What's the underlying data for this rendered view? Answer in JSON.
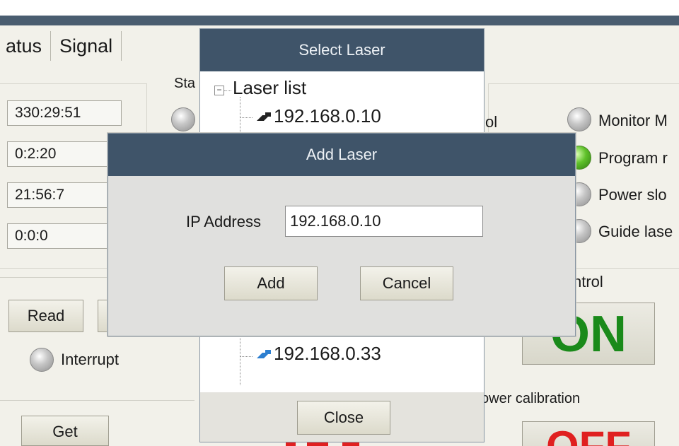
{
  "tabs": [
    "atus",
    "Signal"
  ],
  "left_panel": {
    "fields": [
      "330:29:51",
      "0:2:20",
      "21:56:7",
      "0:0:0"
    ],
    "read_button": "Read",
    "interrupt_label": "Interrupt",
    "get_button": "Get"
  },
  "middle": {
    "status_label_partial": "Sta"
  },
  "right_panel": {
    "control_partial": "ol",
    "indicators": [
      "Monitor M",
      "Program r",
      "Power slo",
      "Guide lase"
    ],
    "indicator_states": [
      "off",
      "on",
      "off",
      "off"
    ],
    "control_group_label": "ntrol",
    "on_button": "ON",
    "power_calibration_label": "ower  calibration",
    "off_button": "OFF"
  },
  "select_laser": {
    "title": "Select Laser",
    "tree_root": "Laser list",
    "items": [
      "192.168.0.10",
      "192.168.0.33"
    ],
    "close_button": "Close"
  },
  "add_laser": {
    "title": "Add Laser",
    "ip_label": "IP Address",
    "ip_value": "192.168.0.10",
    "add_button": "Add",
    "cancel_button": "Cancel"
  },
  "colors": {
    "title_bar": "#3f5469",
    "on_text": "#1a8a1a",
    "off_text": "#e02020",
    "led_on": "#5fc12a"
  }
}
